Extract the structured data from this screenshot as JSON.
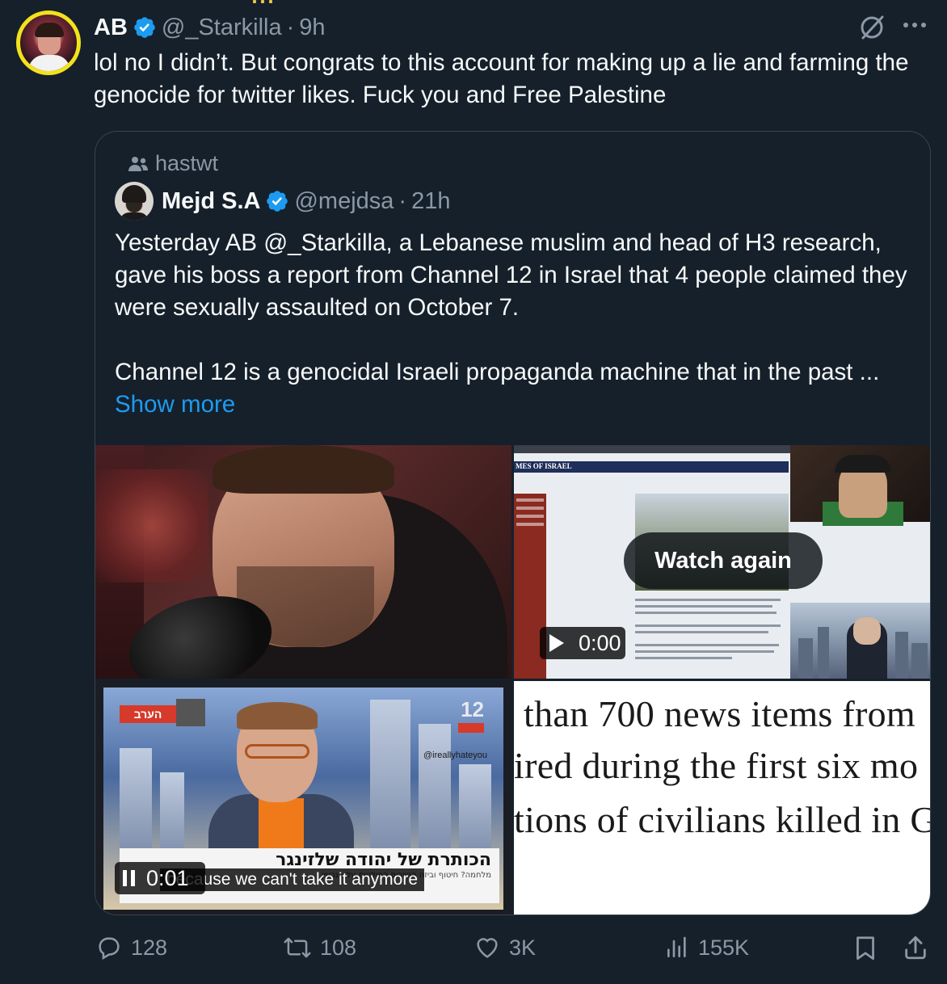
{
  "tweet": {
    "author_name": "AB",
    "author_handle": "@_Starkilla",
    "separator": "·",
    "time": "9h",
    "text": "lol no I didn’t. But congrats to this account for making up a lie and farming the genocide for twitter likes. Fuck you and Free Palestine"
  },
  "quote": {
    "retweeted_by": "hastwt",
    "author_name": "Mejd S.A",
    "author_handle": "@mejdsa",
    "separator": "·",
    "time": "21h",
    "text_p1": "Yesterday AB @_Starkilla, a Lebanese muslim and head of H3 research, gave his boss a report from Channel 12 in Israel that 4 people claimed they were sexually assaulted on October 7.",
    "text_p2": "Channel 12 is a genocidal Israeli propaganda machine that in the past ...",
    "show_more": "Show more",
    "media": {
      "video1": {
        "overlay_button": "Watch again",
        "duration": "0:00",
        "site_nav": "MES OF ISRAEL"
      },
      "video2": {
        "time": "0:01",
        "caption": "because we can't take it anymore",
        "ticker_title": "הכותרת של יהודה שלזינגר",
        "watermark": "@ireallyhateyou",
        "channel_logo": "12",
        "left_badge": "הערב"
      },
      "article_lines": [
        "than 700 news items from",
        "ired during the first six mo",
        "tions of civilians killed in G"
      ]
    }
  },
  "actions": {
    "replies": "128",
    "reposts": "108",
    "likes": "3K",
    "views": "155K"
  },
  "colors": {
    "background": "#15202b",
    "accent": "#1d9bf0",
    "muted": "#8b98a5",
    "avatar_ring": "#f2e21b"
  }
}
